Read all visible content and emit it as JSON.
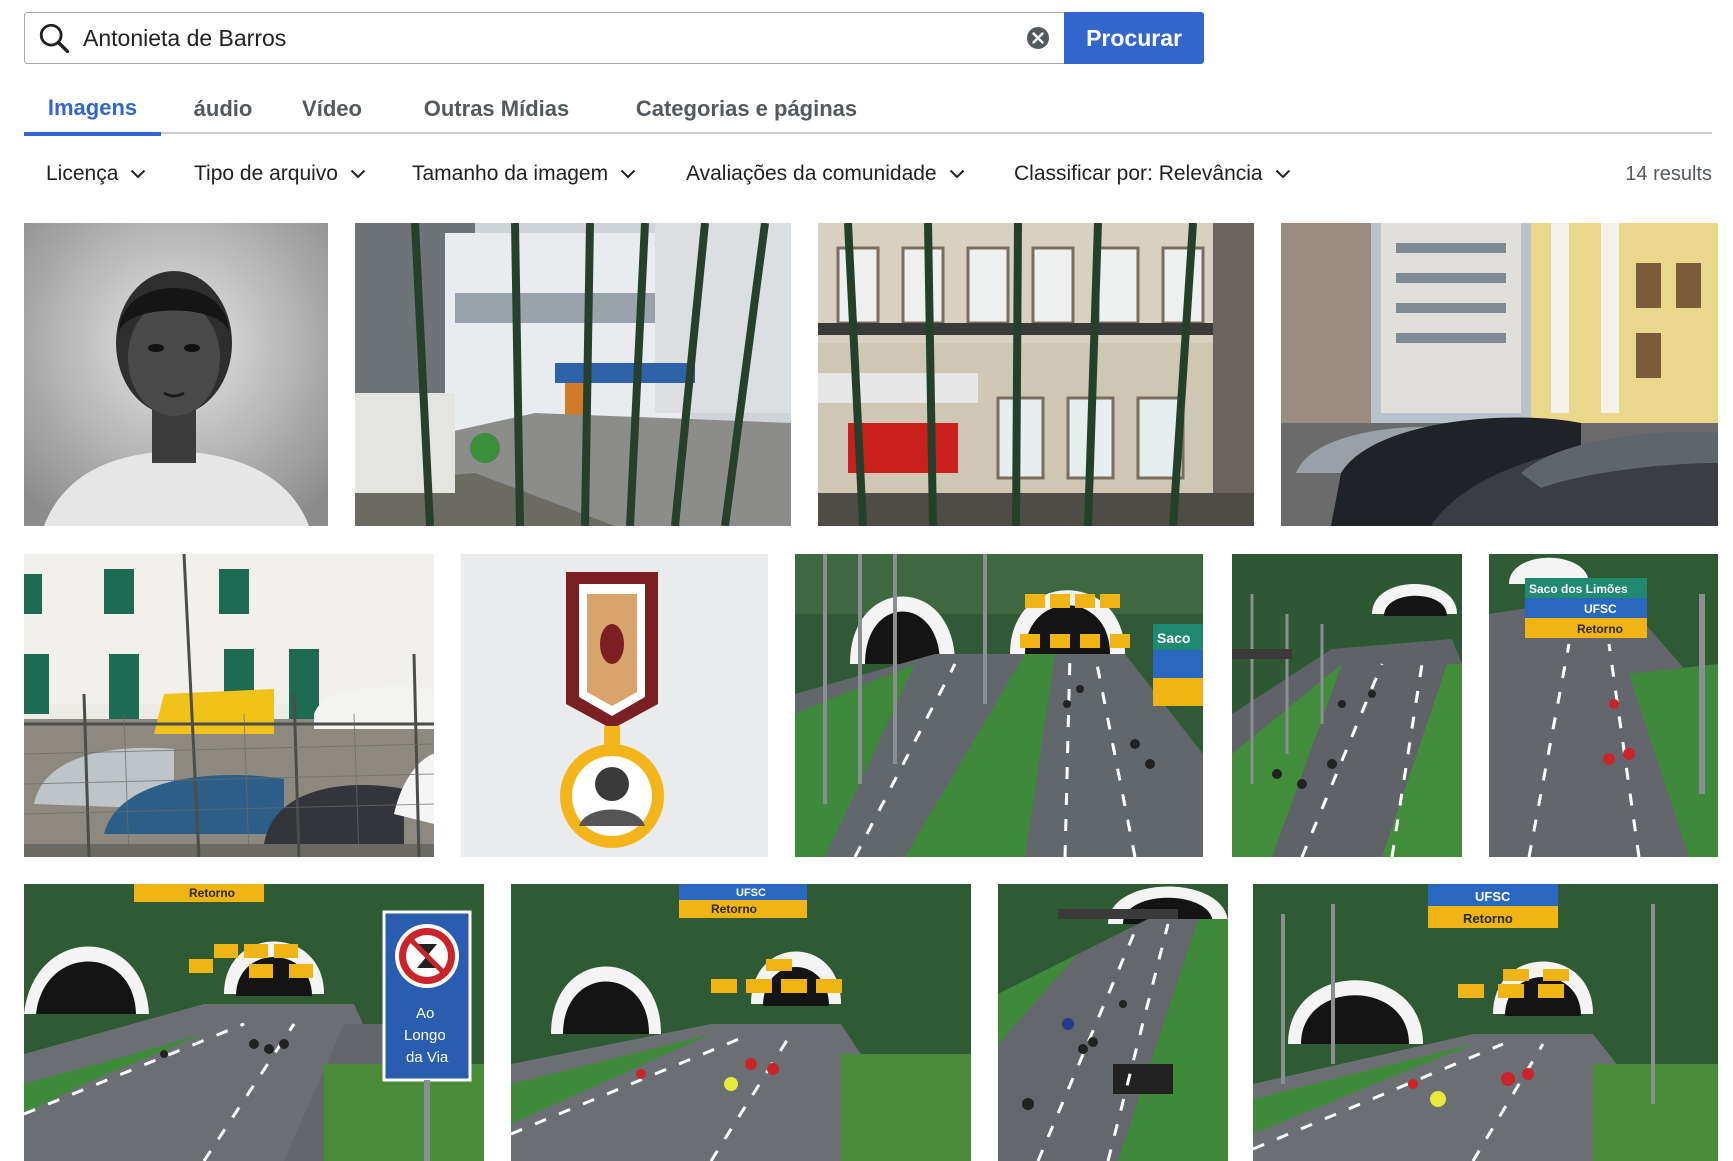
{
  "search": {
    "value": "Antonieta de Barros",
    "placeholder": "",
    "button_label": "Procurar"
  },
  "tabs": [
    {
      "label": "Imagens",
      "active": true
    },
    {
      "label": "áudio",
      "active": false
    },
    {
      "label": "Vídeo",
      "active": false
    },
    {
      "label": "Outras Mídias",
      "active": false
    },
    {
      "label": "Categorias e páginas",
      "active": false
    }
  ],
  "filters": [
    {
      "label": "Licença"
    },
    {
      "label": "Tipo de arquivo"
    },
    {
      "label": "Tamanho da imagem"
    },
    {
      "label": "Avaliações da comunidade"
    },
    {
      "label": "Classificar por: Relevância"
    }
  ],
  "result_count": "14 results",
  "images": [
    {
      "subject": "portrait-photo"
    },
    {
      "subject": "street-through-fence"
    },
    {
      "subject": "building-facade-through-fence"
    },
    {
      "subject": "parked-cars-buildings"
    },
    {
      "subject": "cars-behind-fence"
    },
    {
      "subject": "medal-illustration"
    },
    {
      "subject": "tunnel-road-cyclists"
    },
    {
      "subject": "tunnel-road-cyclists"
    },
    {
      "subject": "road-signs-cyclists"
    },
    {
      "subject": "tunnel-road-sign-cyclists"
    },
    {
      "subject": "tunnel-road-cyclists"
    },
    {
      "subject": "road-cyclists"
    },
    {
      "subject": "tunnel-road-cyclists"
    }
  ],
  "signs": {
    "saco_dos_limoes": "Saco dos Limões",
    "ufsc": "UFSC",
    "retorno": "Retorno",
    "saco_partial": "Saco",
    "ao_longo_da_via": [
      "Ao",
      "Longo",
      "da Via"
    ]
  },
  "colors": {
    "accent": "#3366cc",
    "tab_inactive": "#54595d",
    "border": "#a2a9b1"
  }
}
